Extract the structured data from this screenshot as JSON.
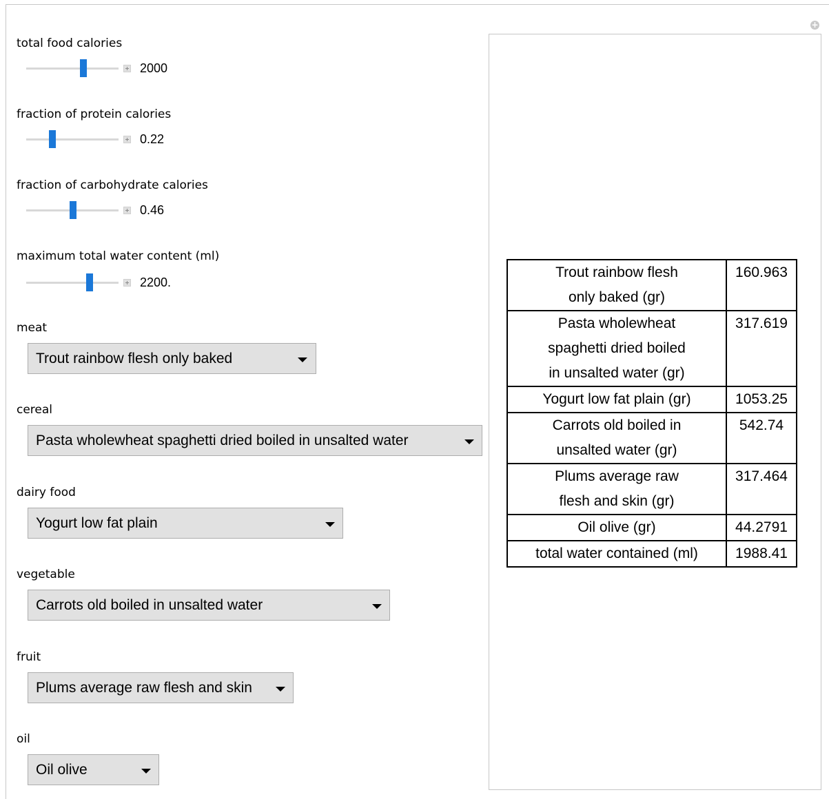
{
  "controls": {
    "total_calories": {
      "label": "total food calories",
      "value": "2000",
      "fraction": 0.62
    },
    "protein": {
      "label": "fraction of protein calories",
      "value": "0.22",
      "fraction": 0.28
    },
    "carbohydrate": {
      "label": "fraction of carbohydrate calories",
      "value": "0.46",
      "fraction": 0.51
    },
    "water": {
      "label": "maximum total water content (ml)",
      "value": "2200.",
      "fraction": 0.69
    }
  },
  "selectors": {
    "meat": {
      "label": "meat",
      "selected": "Trout rainbow flesh only baked"
    },
    "cereal": {
      "label": "cereal",
      "selected": "Pasta wholewheat spaghetti dried boiled in unsalted water"
    },
    "dairy": {
      "label": "dairy food",
      "selected": "Yogurt low fat plain"
    },
    "vegetable": {
      "label": "vegetable",
      "selected": "Carrots old boiled in unsalted water"
    },
    "fruit": {
      "label": "fruit",
      "selected": "Plums average raw flesh and skin"
    },
    "oil": {
      "label": "oil",
      "selected": "Oil olive"
    }
  },
  "results": [
    {
      "name_l1": "Trout rainbow flesh",
      "name_l2": "only baked (gr)",
      "name_l3": "",
      "value": "160.963"
    },
    {
      "name_l1": "Pasta wholewheat",
      "name_l2": "spaghetti dried boiled",
      "name_l3": "in unsalted water (gr)",
      "value": "317.619"
    },
    {
      "name_l1": "Yogurt low fat plain (gr)",
      "name_l2": "",
      "name_l3": "",
      "value": "1053.25"
    },
    {
      "name_l1": "Carrots old boiled in",
      "name_l2": "unsalted water (gr)",
      "name_l3": "",
      "value": "542.74"
    },
    {
      "name_l1": "Plums average raw",
      "name_l2": "flesh and skin (gr)",
      "name_l3": "",
      "value": "317.464"
    },
    {
      "name_l1": "Oil olive (gr)",
      "name_l2": "",
      "name_l3": "",
      "value": "44.2791"
    },
    {
      "name_l1": "total water contained (ml)",
      "name_l2": "",
      "name_l3": "",
      "value": "1988.41"
    }
  ]
}
